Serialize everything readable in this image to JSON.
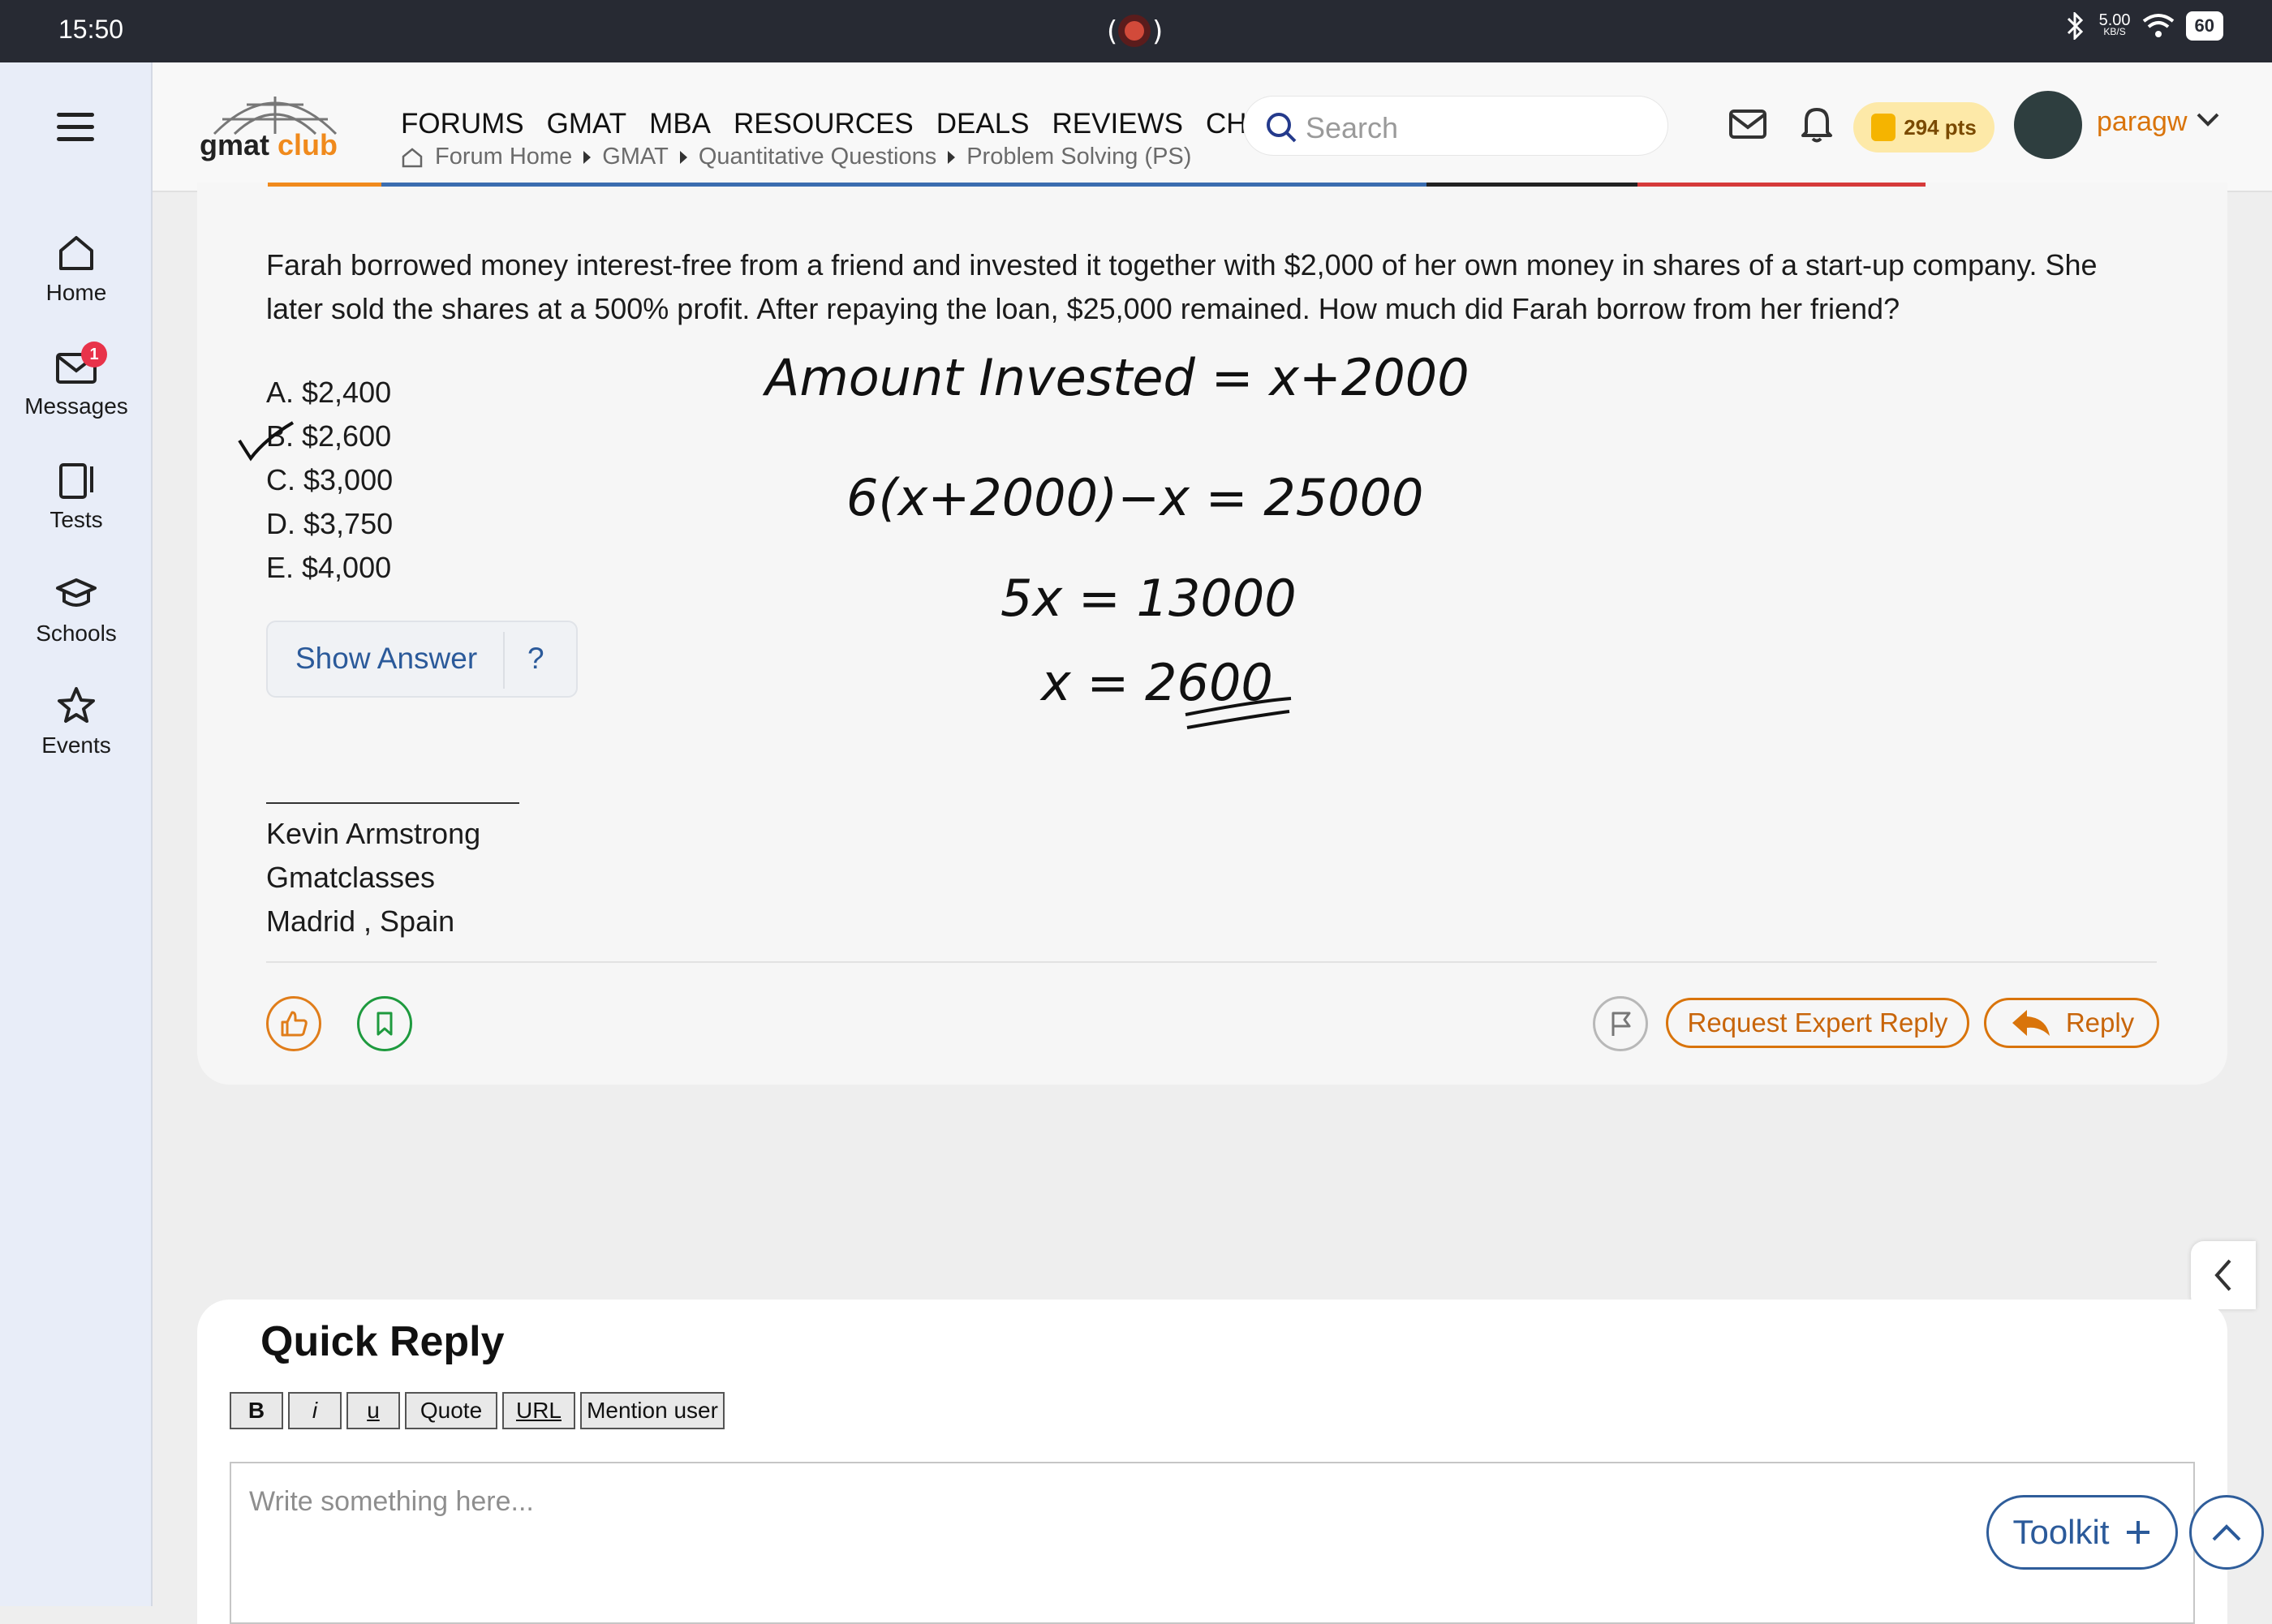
{
  "status_bar": {
    "time": "15:50",
    "speed": "5.00",
    "speed_unit": "KB/S",
    "battery": "60"
  },
  "left_nav": {
    "items": [
      {
        "label": "Home",
        "icon": "home-icon"
      },
      {
        "label": "Messages",
        "icon": "mail-icon",
        "badge": "1"
      },
      {
        "label": "Tests",
        "icon": "test-icon"
      },
      {
        "label": "Schools",
        "icon": "graduation-cap-icon"
      },
      {
        "label": "Events",
        "icon": "star-icon"
      }
    ]
  },
  "header": {
    "logo": "gmatclub",
    "nav": [
      "FORUMS",
      "GMAT",
      "MBA",
      "RESOURCES",
      "DEALS",
      "REVIEWS",
      "CHAT"
    ],
    "breadcrumb": [
      "Forum Home",
      "GMAT",
      "Quantitative Questions",
      "Problem Solving (PS)"
    ],
    "search_placeholder": "Search",
    "points": "294 pts",
    "username": "paragw"
  },
  "post": {
    "question": "Farah borrowed money interest-free from a friend and invested it together with $2,000 of her own money in shares of a start-up company. She later sold the shares at a 500% profit. After repaying the loan, $25,000 remained. How much did Farah borrow from her friend?",
    "choices": [
      "A. $2,400",
      "B. $2,600",
      "C. $3,000",
      "D. $3,750",
      "E. $4,000"
    ],
    "show_answer": "Show Answer",
    "help": "?",
    "signature": [
      "Kevin Armstrong",
      "Gmatclasses",
      "Madrid , Spain"
    ],
    "handwriting": [
      "Amount Invested = x+2000",
      "6(x+2000)−x = 25000",
      "5x = 13000",
      "x = 2600"
    ],
    "request_expert": "Request Expert Reply",
    "reply": "Reply"
  },
  "quick_reply": {
    "title": "Quick Reply",
    "toolbar": [
      "B",
      "i",
      "u",
      "Quote",
      "URL",
      "Mention user"
    ],
    "placeholder": "Write something here...",
    "toolkit": "Toolkit"
  }
}
